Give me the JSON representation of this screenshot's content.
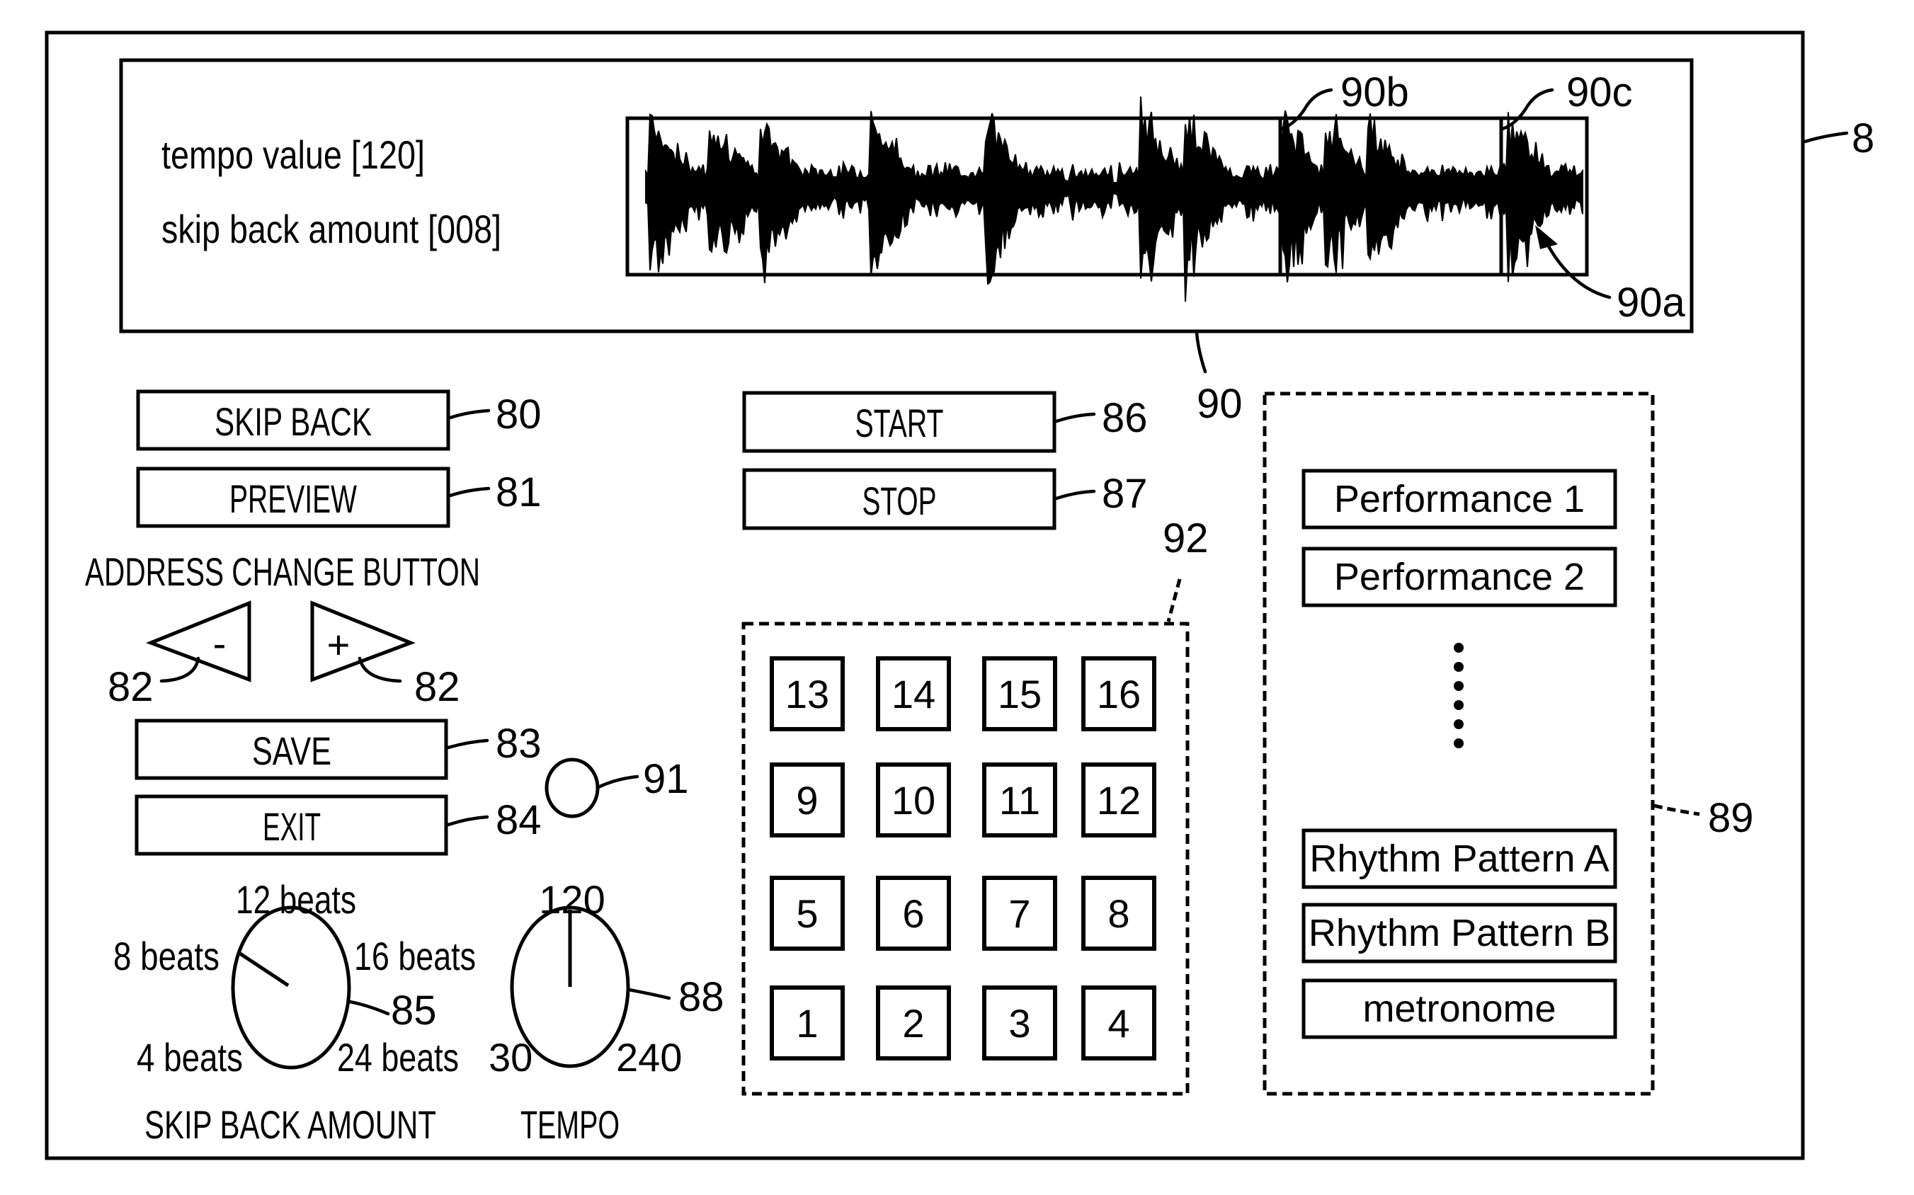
{
  "display": {
    "tempo_text": "tempo value [120]",
    "skip_back_text": "skip back amount [008]",
    "waveform_markers": [
      "90b",
      "90c"
    ],
    "playback_position_label": "90a",
    "ref": "90"
  },
  "frame_ref": "8",
  "buttons": {
    "skip_back": {
      "label": "SKIP BACK",
      "ref": "80"
    },
    "preview": {
      "label": "PREVIEW",
      "ref": "81"
    },
    "address_change_title": "ADDRESS CHANGE BUTTON",
    "address_minus": {
      "symbol": "-",
      "ref": "82"
    },
    "address_plus": {
      "symbol": "+",
      "ref": "82"
    },
    "save": {
      "label": "SAVE",
      "ref": "83"
    },
    "exit": {
      "label": "EXIT",
      "ref": "84"
    },
    "start": {
      "label": "START",
      "ref": "86"
    },
    "stop": {
      "label": "STOP",
      "ref": "87"
    },
    "indicator_ref": "91"
  },
  "skip_back_knob": {
    "title": "SKIP BACK AMOUNT",
    "ref": "85",
    "options": [
      "4 beats",
      "8 beats",
      "12 beats",
      "16 beats",
      "24 beats"
    ],
    "selected": "8 beats"
  },
  "tempo_knob": {
    "title": "TEMPO",
    "ref": "88",
    "min_label": "30",
    "mid_label": "120",
    "max_label": "240",
    "value": 120
  },
  "pads": {
    "ref": "92",
    "rows": [
      [
        "13",
        "14",
        "15",
        "16"
      ],
      [
        "9",
        "10",
        "11",
        "12"
      ],
      [
        "5",
        "6",
        "7",
        "8"
      ],
      [
        "1",
        "2",
        "3",
        "4"
      ]
    ]
  },
  "selection_list": {
    "ref": "89",
    "items_top": [
      "Performance 1",
      "Performance 2"
    ],
    "items_bottom": [
      "Rhythm Pattern A",
      "Rhythm Pattern B",
      "metronome"
    ]
  }
}
